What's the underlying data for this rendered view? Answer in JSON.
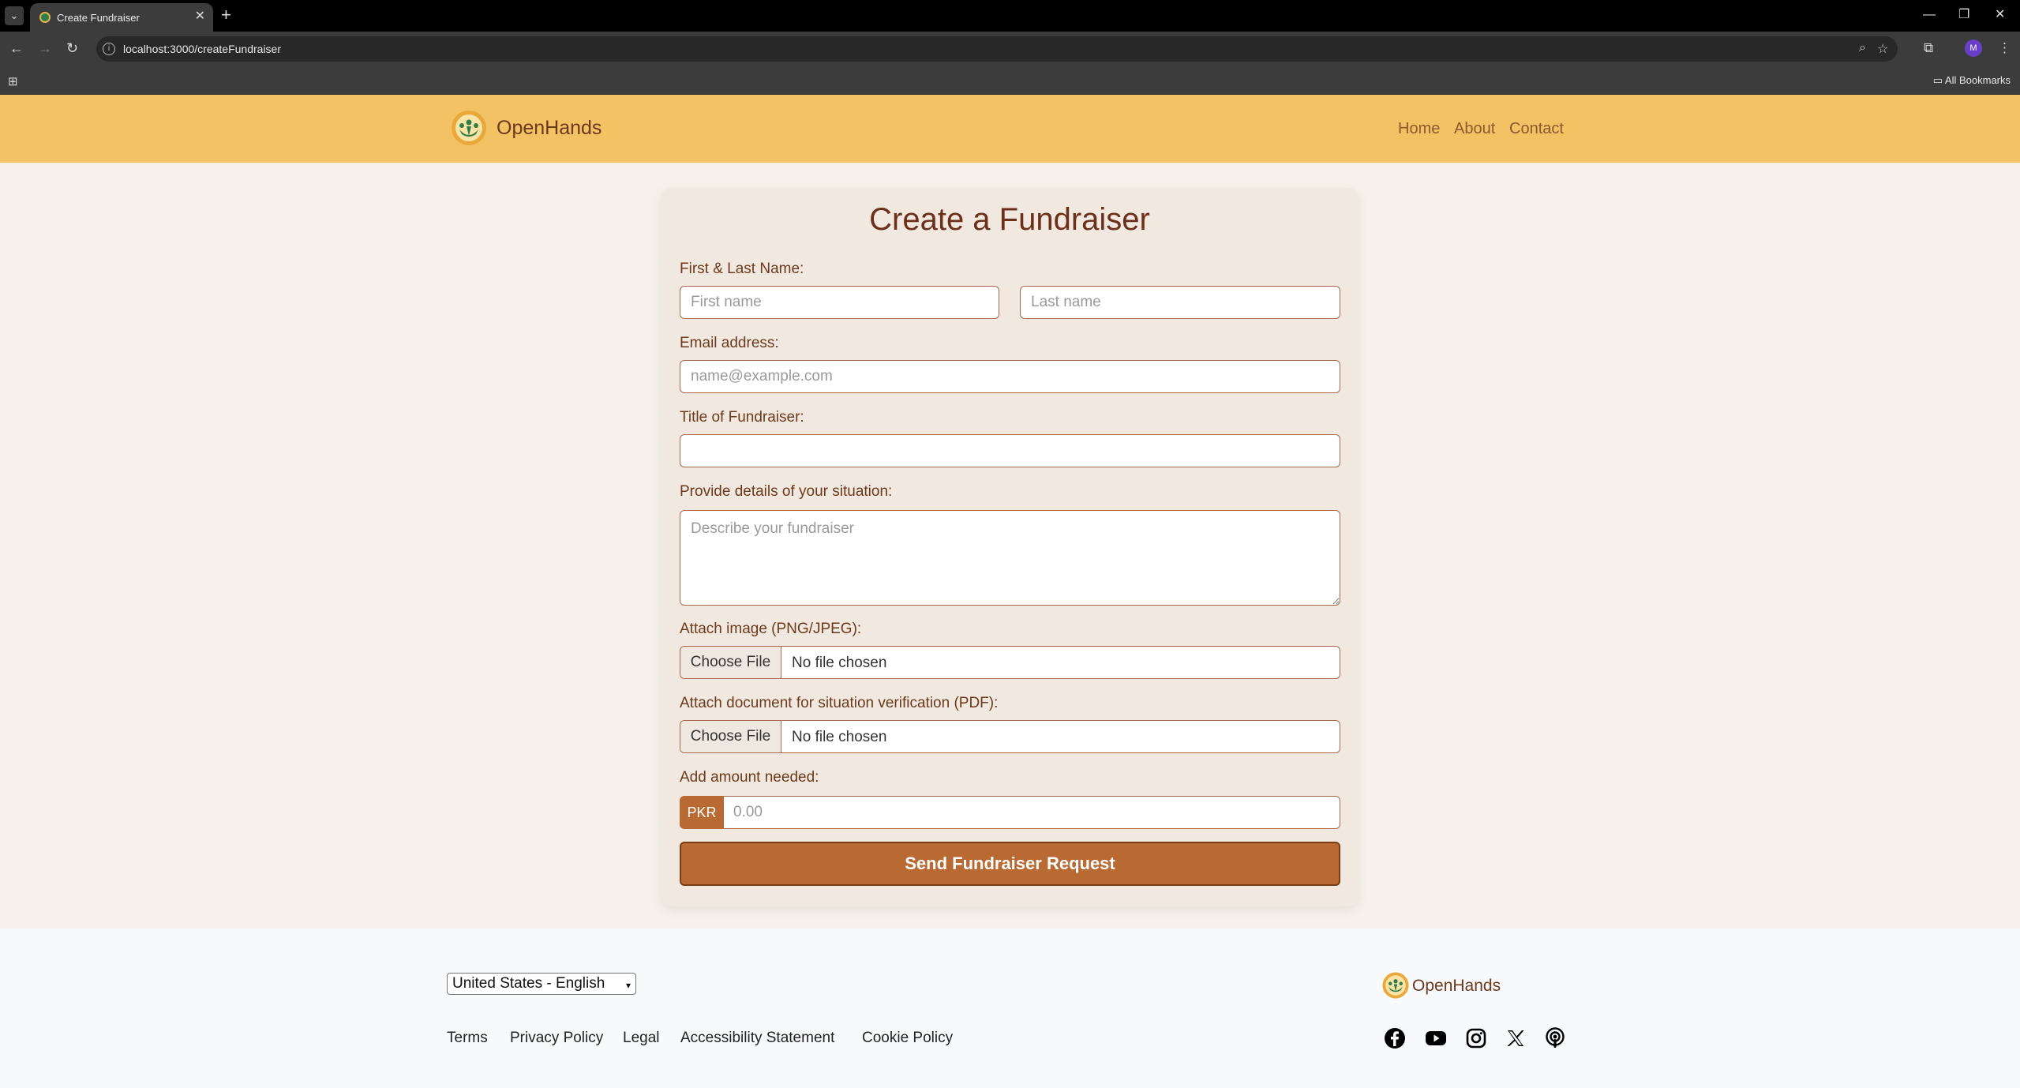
{
  "browser": {
    "tab_title": "Create Fundraiser",
    "url": "localhost:3000/createFundraiser",
    "bookmarks_label": "All Bookmarks",
    "profile_initial": "M"
  },
  "header": {
    "brand": "OpenHands",
    "nav": [
      "Home",
      "About",
      "Contact"
    ]
  },
  "form": {
    "title": "Create a Fundraiser",
    "name_label": "First & Last Name:",
    "first_name_placeholder": "First name",
    "last_name_placeholder": "Last name",
    "email_label": "Email address:",
    "email_placeholder": "name@example.com",
    "title_label": "Title of Fundraiser:",
    "details_label": "Provide details of your situation:",
    "details_placeholder": "Describe your fundraiser",
    "image_label": "Attach image (PNG/JPEG):",
    "document_label": "Attach document for situation verification (PDF):",
    "file_button": "Choose File",
    "no_file": "No file chosen",
    "amount_label": "Add amount needed:",
    "currency": "PKR",
    "amount_placeholder": "0.00",
    "submit": "Send Fundraiser Request"
  },
  "footer": {
    "language": "United States - English",
    "links": [
      "Terms",
      "Privacy Policy",
      "Legal",
      "Accessibility Statement",
      "Cookie Policy"
    ],
    "brand": "OpenHands",
    "social_icons": [
      "facebook-icon",
      "youtube-icon",
      "instagram-icon",
      "x-icon",
      "podcast-icon"
    ]
  },
  "colors": {
    "header_bg": "#f2c265",
    "accent": "#b86a32",
    "title": "#6b2f1c"
  }
}
